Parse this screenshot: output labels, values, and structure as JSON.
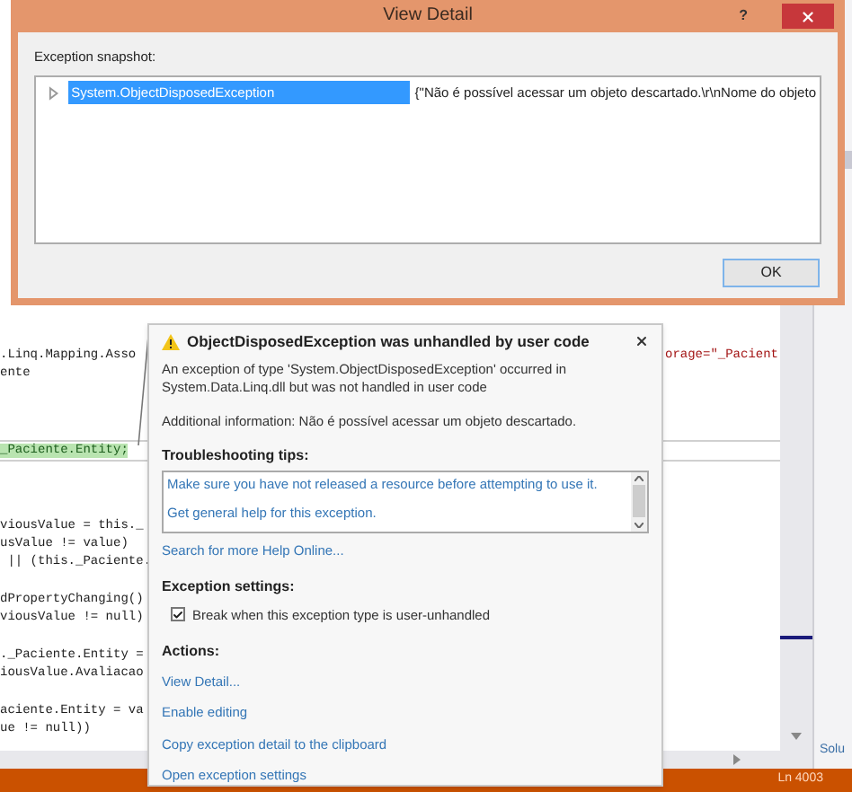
{
  "dialog": {
    "title": "View Detail",
    "help_button": "?",
    "snapshot_label": "Exception snapshot:",
    "rows": [
      {
        "name": "System.ObjectDisposedException",
        "value": "{\"Não é possível acessar um objeto descartado.\\r\\nNome do objeto",
        "selected": true,
        "expanded": false
      }
    ],
    "ok_button": "OK"
  },
  "editor": {
    "blocks": [
      [
        {
          "text": ".Linq.Mapping.Asso",
          "highlighted": false
        },
        {
          "text": "ente",
          "highlighted": false
        }
      ],
      [
        {
          "text": "_Paciente.Entity;",
          "highlighted": true
        }
      ],
      [
        {
          "text": "viousValue = this._",
          "highlighted": false
        },
        {
          "text": "usValue != value)",
          "highlighted": false
        },
        {
          "text": " || (this._Paciente.",
          "highlighted": false
        }
      ],
      [
        {
          "text": "dPropertyChanging()",
          "highlighted": false
        },
        {
          "text": "viousValue != null)",
          "highlighted": false
        }
      ],
      [
        {
          "text": "._Paciente.Entity =",
          "highlighted": false
        },
        {
          "text": "iousValue.Avaliacao",
          "highlighted": false
        }
      ],
      [
        {
          "text": "aciente.Entity = va",
          "highlighted": false
        },
        {
          "text": "ue != null))",
          "highlighted": false
        }
      ]
    ],
    "right_fragment": "orage=\"_Pacient"
  },
  "exception_popup": {
    "title": "ObjectDisposedException was unhandled by user code",
    "message": "An exception of type 'System.ObjectDisposedException' occurred in System.Data.Linq.dll but was not handled in user code",
    "additional_info": "Additional information: Não é possível acessar um objeto descartado.",
    "tips_heading": "Troubleshooting tips:",
    "tips": [
      "Make sure you have not released a resource before attempting to use it.",
      "Get general help for this exception."
    ],
    "search_link": "Search for more Help Online...",
    "settings_heading": "Exception settings:",
    "break_checkbox": {
      "label": "Break when this exception type is user-unhandled",
      "checked": true
    },
    "actions_heading": "Actions:",
    "actions": [
      "View Detail...",
      "Enable editing",
      "Copy exception detail to the clipboard",
      "Open exception settings"
    ]
  },
  "side_panel": {
    "tab": "Solu"
  },
  "status_bar": {
    "position": "Ln 4003"
  }
}
